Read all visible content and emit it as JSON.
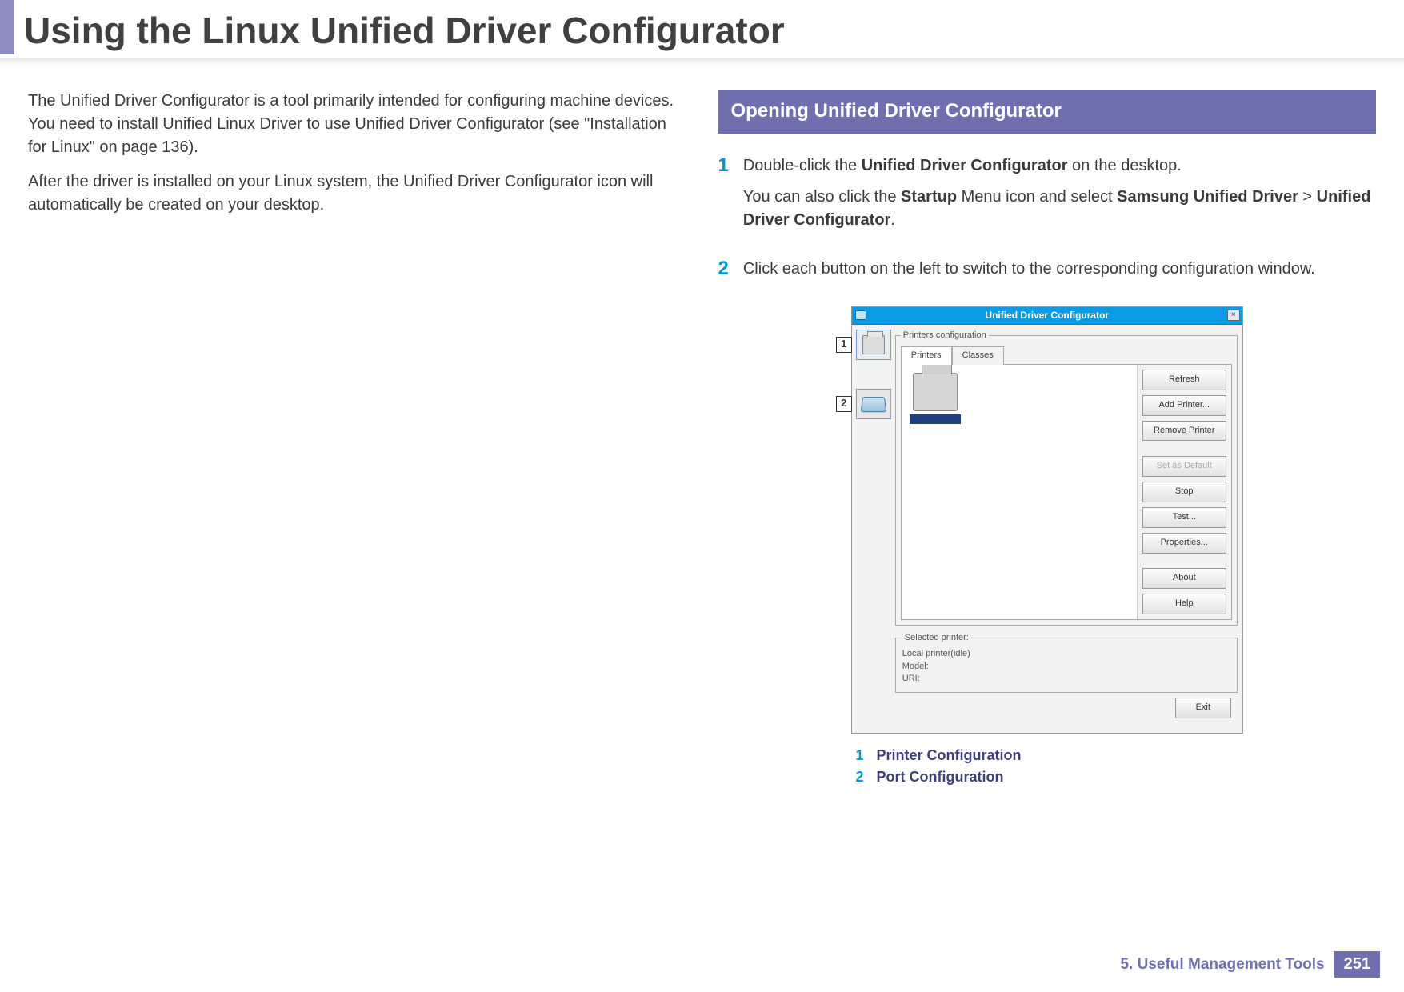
{
  "page": {
    "title": "Using the Linux Unified Driver Configurator",
    "chapter": "5.  Useful Management Tools",
    "number": "251"
  },
  "left": {
    "p1": "The Unified Driver Configurator is a tool primarily intended for configuring machine devices. You need to install Unified Linux Driver to use Unified Driver Configurator (see \"Installation for Linux\" on page 136).",
    "p2": "After the driver is installed on your Linux system, the Unified Driver Configurator icon will automatically be created on your desktop."
  },
  "right": {
    "section": "Opening Unified Driver Configurator",
    "step1": {
      "num": "1",
      "line1_a": "Double-click the ",
      "line1_b": "Unified Driver Configurator",
      "line1_c": " on the desktop.",
      "line2_a": "You can also click the ",
      "line2_b": "Startup",
      "line2_c": " Menu icon and select ",
      "line2_d": "Samsung Unified Driver",
      "line2_e": " > ",
      "line2_f": "Unified Driver Configurator",
      "line2_g": "."
    },
    "step2": {
      "num": "2",
      "text": "Click each button on the left to switch to the corresponding configuration window."
    }
  },
  "figure": {
    "title": "Unified Driver Configurator",
    "close": "×",
    "callout1": "1",
    "callout2": "2",
    "fieldset_label": "Printers configuration",
    "tab_printers": "Printers",
    "tab_classes": "Classes",
    "buttons": {
      "refresh": "Refresh",
      "add": "Add Printer...",
      "remove": "Remove Printer",
      "default": "Set as Default",
      "stop": "Stop",
      "test": "Test...",
      "props": "Properties...",
      "about": "About",
      "help": "Help",
      "exit": "Exit"
    },
    "selected_label": "Selected printer:",
    "sel_line1": "Local printer(idle)",
    "sel_line2": "Model:",
    "sel_line3": "URI:"
  },
  "legend": {
    "n1": "1",
    "t1": "Printer Configuration",
    "n2": "2",
    "t2": "Port Configuration"
  }
}
